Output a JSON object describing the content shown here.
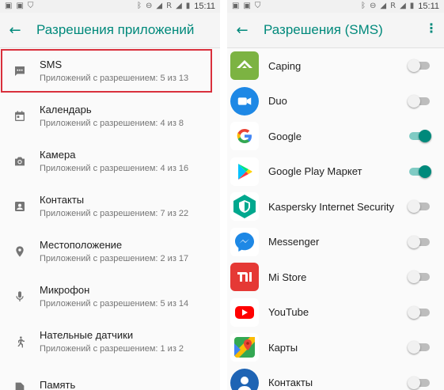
{
  "colors": {
    "accent": "#00897b",
    "highlight_border": "#d9303c"
  },
  "left_panel": {
    "status_bar": {
      "time": "15:11",
      "carrier": "R"
    },
    "title": "Разрешения приложений",
    "permissions": [
      {
        "name": "SMS",
        "detail": "Приложений с разрешением: 5 из 13",
        "icon": "sms-icon",
        "highlighted": true
      },
      {
        "name": "Календарь",
        "detail": "Приложений с разрешением: 4 из 8",
        "icon": "calendar-icon"
      },
      {
        "name": "Камера",
        "detail": "Приложений с разрешением: 4 из 16",
        "icon": "camera-icon"
      },
      {
        "name": "Контакты",
        "detail": "Приложений с разрешением: 7 из 22",
        "icon": "contacts-icon"
      },
      {
        "name": "Местоположение",
        "detail": "Приложений с разрешением: 2 из 17",
        "icon": "location-icon"
      },
      {
        "name": "Микрофон",
        "detail": "Приложений с разрешением: 5 из 14",
        "icon": "microphone-icon"
      },
      {
        "name": "Нательные датчики",
        "detail": "Приложений с разрешением: 1 из 2",
        "icon": "body-sensors-icon"
      },
      {
        "name": "Память",
        "detail": "",
        "icon": "storage-icon"
      }
    ]
  },
  "right_panel": {
    "status_bar": {
      "time": "15:11",
      "carrier": "R"
    },
    "title": "Разрешения (SMS)",
    "apps": [
      {
        "name": "Caping",
        "icon": "caping-app-icon",
        "enabled": false
      },
      {
        "name": "Duo",
        "icon": "duo-app-icon",
        "enabled": false
      },
      {
        "name": "Google",
        "icon": "google-app-icon",
        "enabled": true
      },
      {
        "name": "Google Play Маркет",
        "icon": "google-play-app-icon",
        "enabled": true
      },
      {
        "name": "Kaspersky Internet Security",
        "icon": "kaspersky-app-icon",
        "enabled": false
      },
      {
        "name": "Messenger",
        "icon": "messenger-app-icon",
        "enabled": false
      },
      {
        "name": "Mi Store",
        "icon": "mi-store-app-icon",
        "enabled": false
      },
      {
        "name": "YouTube",
        "icon": "youtube-app-icon",
        "enabled": false
      },
      {
        "name": "Карты",
        "icon": "maps-app-icon",
        "enabled": false
      },
      {
        "name": "Контакты",
        "icon": "contacts-app-icon",
        "enabled": false
      }
    ]
  }
}
